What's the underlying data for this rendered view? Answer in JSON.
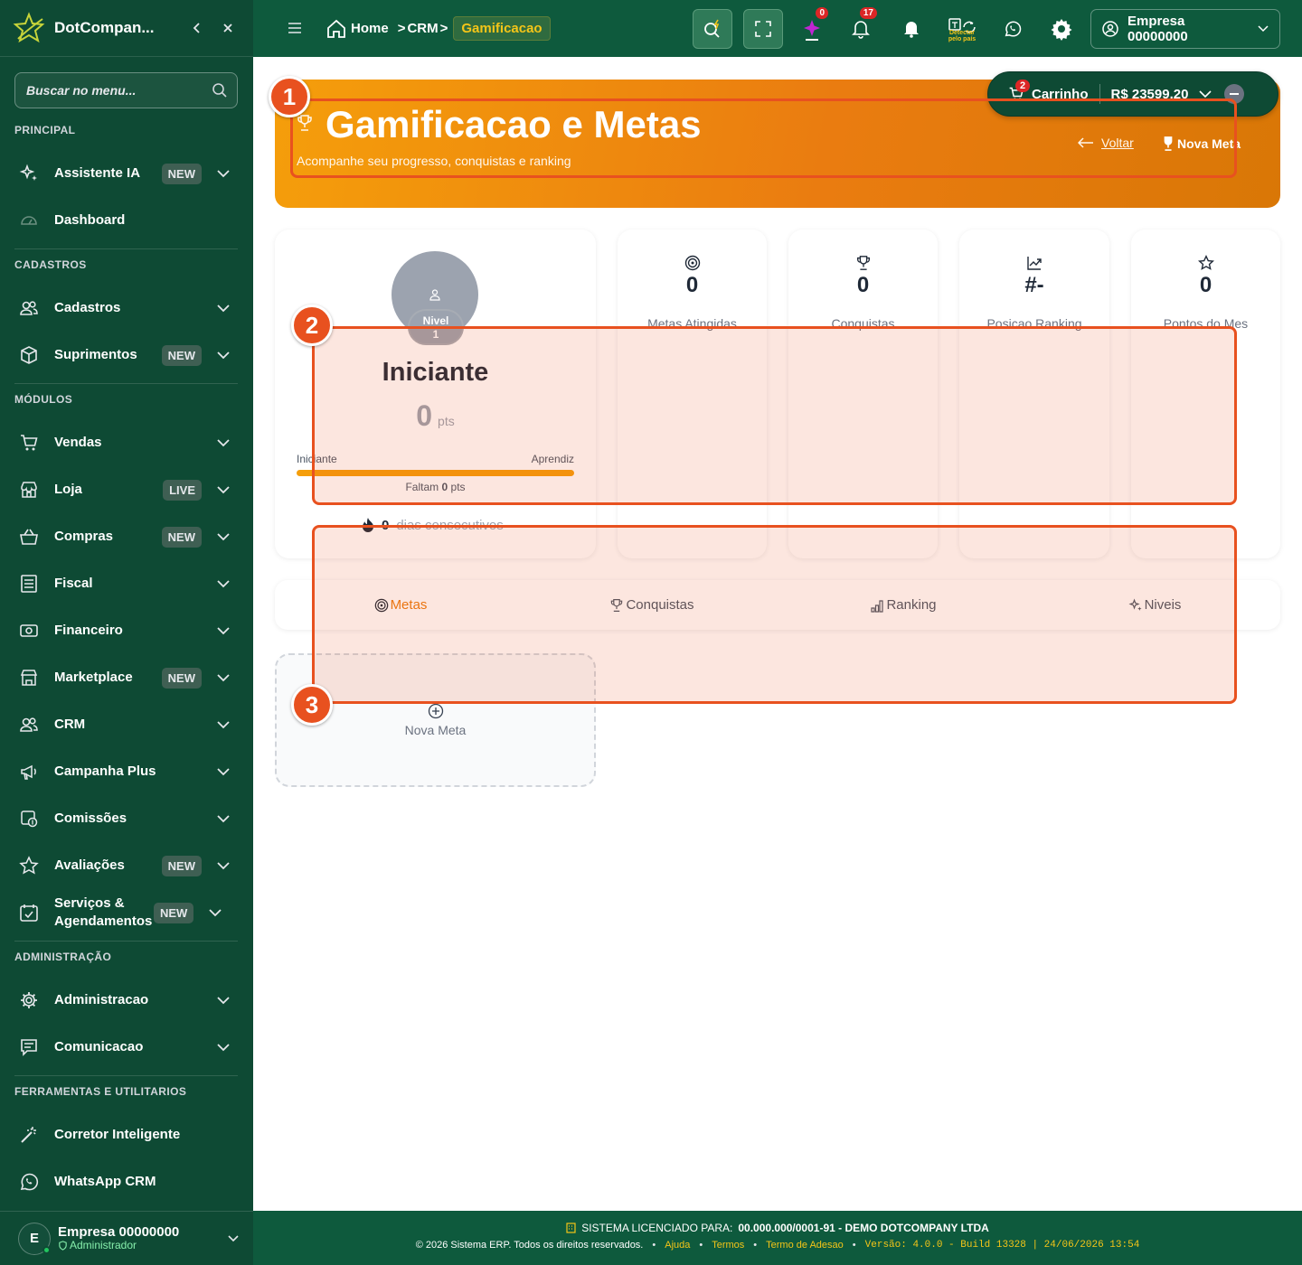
{
  "brand": {
    "name": "DotCompan..."
  },
  "sidebar": {
    "search_placeholder": "Buscar no menu...",
    "sections": [
      "PRINCIPAL",
      "CADASTROS",
      "MÓDULOS",
      "ADMINISTRAÇÃO",
      "FERRAMENTAS E UTILITARIOS"
    ],
    "items": [
      {
        "label": "Assistente IA",
        "badge": "NEW",
        "icon": "sparkles-icon"
      },
      {
        "label": "Dashboard",
        "badge": "",
        "icon": "gauge-icon"
      },
      {
        "label": "Cadastros",
        "badge": "",
        "icon": "users-icon"
      },
      {
        "label": "Suprimentos",
        "badge": "NEW",
        "icon": "box-icon"
      },
      {
        "label": "Vendas",
        "badge": "",
        "icon": "cart-icon"
      },
      {
        "label": "Loja",
        "badge": "LIVE",
        "icon": "store-icon"
      },
      {
        "label": "Compras",
        "badge": "NEW",
        "icon": "basket-icon"
      },
      {
        "label": "Fiscal",
        "badge": "",
        "icon": "receipt-icon"
      },
      {
        "label": "Financeiro",
        "badge": "",
        "icon": "money-icon"
      },
      {
        "label": "Marketplace",
        "badge": "NEW",
        "icon": "marketplace-icon"
      },
      {
        "label": "CRM",
        "badge": "",
        "icon": "users-icon"
      },
      {
        "label": "Campanha Plus",
        "badge": "",
        "icon": "megaphone-icon"
      },
      {
        "label": "Comissões",
        "badge": "",
        "icon": "commission-icon"
      },
      {
        "label": "Avaliações",
        "badge": "NEW",
        "icon": "star-icon"
      },
      {
        "label": "Serviços & Agendamentos",
        "badge": "NEW",
        "icon": "calendar-check-icon"
      },
      {
        "label": "Administracao",
        "badge": "",
        "icon": "gear-icon"
      },
      {
        "label": "Comunicacao",
        "badge": "",
        "icon": "message-icon"
      },
      {
        "label": "Corretor Inteligente",
        "badge": "",
        "icon": "magic-wand-icon"
      },
      {
        "label": "WhatsApp CRM",
        "badge": "",
        "icon": "whatsapp-icon"
      }
    ],
    "user": {
      "initial": "E",
      "name": "Empresa 00000000",
      "role": "Administrador"
    }
  },
  "topbar": {
    "breadcrumb": [
      "Home",
      "CRM",
      "Gamificacao"
    ],
    "ai_badge": "0",
    "notifications_badge": "17",
    "detect_label": "Detectar pelo país",
    "company": "Empresa 00000000"
  },
  "cart": {
    "badge": "2",
    "label": "Carrinho",
    "total": "R$ 23599.20"
  },
  "hero": {
    "title": "Gamificacao e Metas",
    "subtitle": "Acompanhe seu progresso, conquistas e ranking",
    "back_label": "Voltar",
    "new_goal_label": "Nova Meta"
  },
  "level": {
    "label": "Nivel",
    "number": "1",
    "name": "Iniciante",
    "points": "0",
    "points_unit": "pts",
    "from_label": "Iniciante",
    "to_label": "Aprendiz",
    "progress_pct": 100,
    "remaining_prefix": "Faltam",
    "remaining_points": "0",
    "remaining_unit": "pts",
    "streak_days": "0",
    "streak_label": "dias consecutivos"
  },
  "stats": [
    {
      "icon": "target-icon",
      "value": "0",
      "label": "Metas Atingidas"
    },
    {
      "icon": "trophy-icon",
      "value": "0",
      "label": "Conquistas"
    },
    {
      "icon": "trend-up-icon",
      "value": "#-",
      "label": "Posicao Ranking"
    },
    {
      "icon": "star-icon",
      "value": "0",
      "label": "Pontos do Mes"
    }
  ],
  "tabs": [
    {
      "label": "Metas",
      "icon": "target-icon",
      "active": true
    },
    {
      "label": "Conquistas",
      "icon": "trophy-icon",
      "active": false
    },
    {
      "label": "Ranking",
      "icon": "bar-chart-icon",
      "active": false
    },
    {
      "label": "Niveis",
      "icon": "sparkles-icon",
      "active": false
    }
  ],
  "new_meta_card": {
    "label": "Nova Meta"
  },
  "markers": [
    "1",
    "2",
    "3"
  ],
  "footer": {
    "license_prefix": "SISTEMA LICENCIADO PARA:",
    "license_holder": "00.000.000/0001-91 - DEMO DOTCOMPANY LTDA",
    "copyright": "© 2026 Sistema ERP. Todos os direitos reservados.",
    "links": [
      "Ajuda",
      "Termos",
      "Termo de Adesao"
    ],
    "version": "Versão: 4.0.0 - Build 13328 | 24/06/2026 13:54"
  },
  "colors": {
    "sidebar": "#0e4a34",
    "topbar": "#0e5a3d",
    "accent": "#f59e0b",
    "highlight": "#e8511f"
  }
}
